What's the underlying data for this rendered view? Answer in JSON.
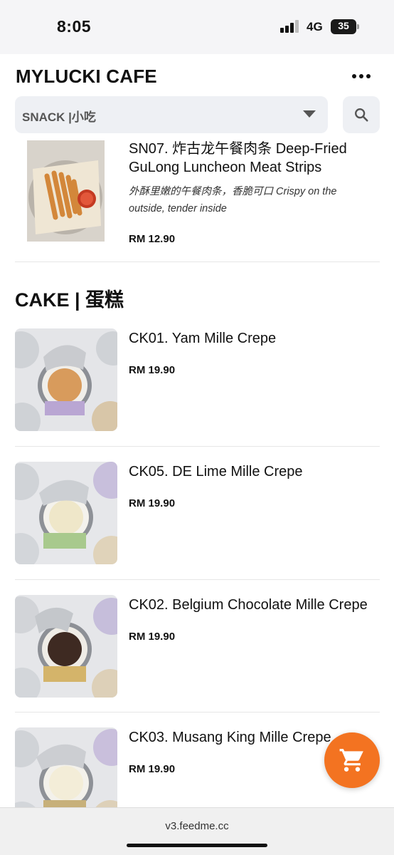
{
  "status_bar": {
    "time": "8:05",
    "network": "4G",
    "battery": "35"
  },
  "header": {
    "shop_name": "MYLUCKI CAFE",
    "category_selected": "SNACK |小吃"
  },
  "sections": [
    {
      "items": [
        {
          "title_line1": "SN07. 炸古龙午餐肉条 Deep-Fried",
          "title_line2": "GuLong Luncheon Meat Strips",
          "desc_line1": "外酥里嫩的午餐肉条，香脆可口 Crispy on the",
          "desc_line2": "outside, tender inside",
          "price": "RM 12.90"
        }
      ]
    },
    {
      "title": "CAKE | 蛋糕",
      "items": [
        {
          "title": "CK01. Yam Mille Crepe",
          "price": "RM 19.90"
        },
        {
          "title": "CK05. DE Lime Mille Crepe",
          "price": "RM 19.90"
        },
        {
          "title": "CK02. Belgium Chocolate Mille Crepe",
          "price": "RM 19.90"
        },
        {
          "title": "CK03. Musang King Mille Crepe",
          "price": "RM 19.90"
        }
      ]
    }
  ],
  "browser": {
    "url": "v3.feedme.cc"
  },
  "colors": {
    "accent": "#f37321",
    "select_bg": "#eef0f4"
  },
  "icons": [
    "signal-icon",
    "battery-icon",
    "more-icon",
    "caret-down-icon",
    "search-icon",
    "cart-icon"
  ]
}
